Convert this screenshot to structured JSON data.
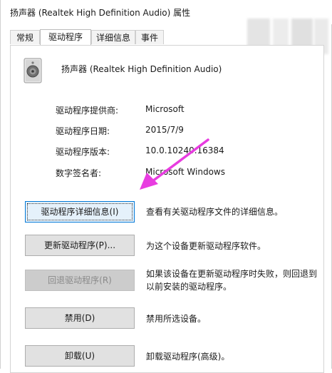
{
  "window": {
    "title": "扬声器 (Realtek High Definition Audio) 属性"
  },
  "tabs": [
    {
      "label": "常规"
    },
    {
      "label": "驱动程序"
    },
    {
      "label": "详细信息"
    },
    {
      "label": "事件"
    }
  ],
  "device": {
    "icon": "speaker-icon",
    "name": "扬声器 (Realtek High Definition Audio)"
  },
  "info": [
    {
      "label": "驱动程序提供商:",
      "value": "Microsoft"
    },
    {
      "label": "驱动程序日期:",
      "value": "2015/7/9"
    },
    {
      "label": "驱动程序版本:",
      "value": "10.0.10240.16384"
    },
    {
      "label": "数字签名者:",
      "value": "Microsoft Windows"
    }
  ],
  "buttons": [
    {
      "label": "驱动程序详细信息(I)",
      "description": "查看有关驱动程序文件的详细信息。",
      "state": "focused"
    },
    {
      "label": "更新驱动程序(P)...",
      "description": "为这个设备更新驱动程序软件。",
      "state": "normal"
    },
    {
      "label": "回退驱动程序(R)",
      "description": "如果该设备在更新驱动程序时失败，则回退到以前安装的驱动程序。",
      "state": "disabled"
    },
    {
      "label": "禁用(D)",
      "description": "禁用所选设备。",
      "state": "normal"
    },
    {
      "label": "卸载(U)",
      "description": "卸载驱动程序(高级)。",
      "state": "normal"
    }
  ],
  "annotation": {
    "arrow_color": "#e83ce0"
  }
}
